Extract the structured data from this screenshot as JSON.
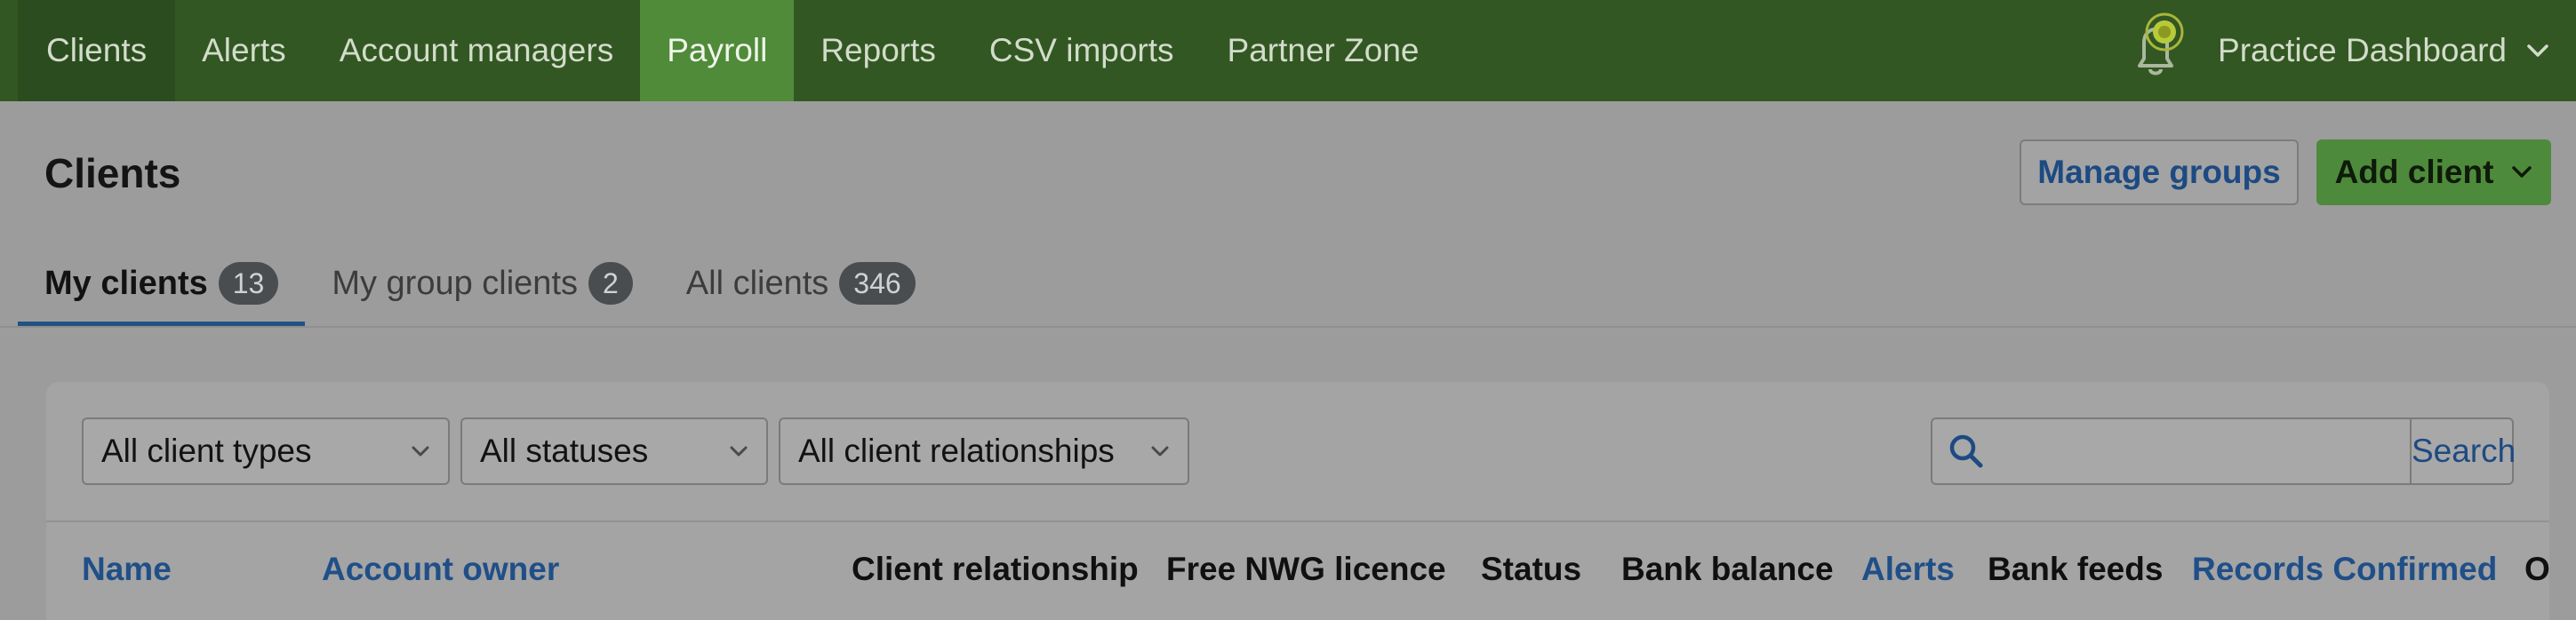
{
  "nav": {
    "items": [
      {
        "label": "Clients"
      },
      {
        "label": "Alerts"
      },
      {
        "label": "Account managers"
      },
      {
        "label": "Payroll"
      },
      {
        "label": "Reports"
      },
      {
        "label": "CSV imports"
      },
      {
        "label": "Partner Zone"
      }
    ],
    "active": "Payroll",
    "practice_label": "Practice Dashboard",
    "bell_icon": "notification-bell-icon",
    "colors": {
      "bar": "#325723",
      "active": "#4f8b39",
      "text": "#d3dccb"
    }
  },
  "header": {
    "title": "Clients",
    "manage_groups_label": "Manage groups",
    "add_client_label": "Add client"
  },
  "tabs": [
    {
      "label": "My clients",
      "count": "13"
    },
    {
      "label": "My group clients",
      "count": "2"
    },
    {
      "label": "All clients",
      "count": "346"
    }
  ],
  "filters": {
    "client_type": "All client types",
    "status": "All statuses",
    "relationship": "All client relationships"
  },
  "search": {
    "value": "",
    "button_label": "Search"
  },
  "table": {
    "columns": [
      {
        "label": "Name",
        "sortable": true
      },
      {
        "label": "Account owner",
        "sortable": true
      },
      {
        "label": "Client relationship",
        "sortable": false
      },
      {
        "label": "Free NWG licence",
        "sortable": false
      },
      {
        "label": "Status",
        "sortable": false
      },
      {
        "label": "Bank balance",
        "sortable": false
      },
      {
        "label": "Alerts",
        "sortable": true
      },
      {
        "label": "Bank feeds",
        "sortable": false
      },
      {
        "label": "Records Confirmed",
        "sortable": true
      },
      {
        "label": "O",
        "sortable": false
      }
    ]
  }
}
